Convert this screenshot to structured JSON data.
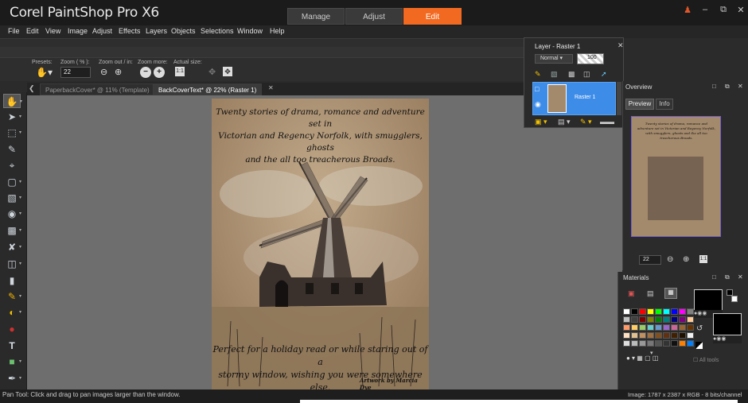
{
  "app": {
    "title": "Corel PaintShop Pro X6"
  },
  "workspace_tabs": [
    {
      "label": "Manage",
      "active": false
    },
    {
      "label": "Adjust",
      "active": false
    },
    {
      "label": "Edit",
      "active": true
    }
  ],
  "menu": [
    "File",
    "Edit",
    "View",
    "Image",
    "Adjust",
    "Effects",
    "Layers",
    "Objects",
    "Selections",
    "Window",
    "Help"
  ],
  "tool_options": {
    "presets_label": "Presets:",
    "zoom_label": "Zoom ( % ):",
    "zoom_value": "22",
    "zoom_out_in_label": "Zoom out / in:",
    "zoom_more_label": "Zoom more:",
    "actual_size_label": "Actual size:"
  },
  "doc_tabs": [
    {
      "label": "PaperbackCover* @  11% (Template)",
      "active": false
    },
    {
      "label": "BackCoverText* @  22% (Raster 1)",
      "active": true
    }
  ],
  "document": {
    "top_text": "Twenty stories of drama, romance and adventure set in Victorian and Regency Norfolk, with smugglers, ghosts and the all too treacherous Broads.",
    "top_lines": [
      "Twenty stories of drama, romance and adventure set in",
      "Victorian and Regency Norfolk, with smugglers, ghosts",
      "and the all too treacherous Broads."
    ],
    "bottom_lines": [
      "Perfect for a holiday read or while staring out of a",
      "stormy window, wishing you were somewhere else."
    ],
    "credit": "Artwork by Marcia Dye"
  },
  "layers_panel": {
    "title": "Layer - Raster 1",
    "blend_mode": "Normal",
    "opacity": "100",
    "layer_name": "Raster 1"
  },
  "overview": {
    "title": "Overview",
    "tabs": [
      "Preview",
      "Info"
    ],
    "zoom_value": "22"
  },
  "materials": {
    "title": "Materials",
    "all_tools_label": "All tools",
    "colors": {
      "foreground": "#000000",
      "background": "#000000",
      "swatches": [
        [
          "#ffffff",
          "#000000",
          "#ff0000",
          "#ffff00",
          "#00ff00",
          "#00ffff",
          "#0000ff",
          "#ff00ff",
          "#808080"
        ],
        [
          "#c0c0c0",
          "#404040",
          "#800000",
          "#808000",
          "#008000",
          "#008080",
          "#000080",
          "#800080",
          "#ffcc99"
        ],
        [
          "#ff9966",
          "#ffcc66",
          "#99cc66",
          "#66cccc",
          "#6699cc",
          "#9966cc",
          "#cc6699",
          "#996633",
          "#663300"
        ],
        [
          "#ffe0c0",
          "#e0c090",
          "#c09060",
          "#a07040",
          "#805020",
          "#603010",
          "#402000",
          "#201000",
          "#f0f0f0"
        ],
        [
          "#dddddd",
          "#bbbbbb",
          "#999999",
          "#777777",
          "#555555",
          "#333333",
          "#111111",
          "#ff8000",
          "#0080ff"
        ]
      ]
    }
  },
  "status": {
    "hint": "Pan Tool: Click and drag to pan images larger than the window.",
    "image_info": "Image:  1787 x 2387 x RGB - 8 bits/channel"
  }
}
